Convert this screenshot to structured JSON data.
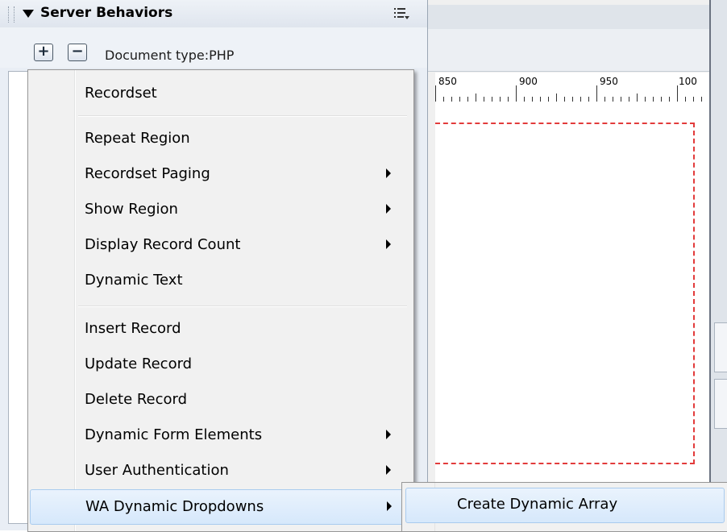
{
  "panel": {
    "title": "Server Behaviors",
    "add_button": "+",
    "remove_button": "−",
    "document_type": "Document type:PHP"
  },
  "ruler": {
    "ticks": [
      "850",
      "900",
      "950",
      "100"
    ]
  },
  "menu": {
    "items": [
      {
        "label": "Recordset",
        "submenu": false
      },
      {
        "label": "Repeat Region",
        "submenu": false
      },
      {
        "label": "Recordset Paging",
        "submenu": true
      },
      {
        "label": "Show Region",
        "submenu": true
      },
      {
        "label": "Display Record Count",
        "submenu": true
      },
      {
        "label": "Dynamic Text",
        "submenu": false
      },
      {
        "label": "Insert Record",
        "submenu": false
      },
      {
        "label": "Update Record",
        "submenu": false
      },
      {
        "label": "Delete Record",
        "submenu": false
      },
      {
        "label": "Dynamic Form Elements",
        "submenu": true
      },
      {
        "label": "User Authentication",
        "submenu": true
      },
      {
        "label": "WA Dynamic Dropdowns",
        "submenu": true,
        "highlighted": true
      }
    ]
  },
  "submenu": {
    "items": [
      {
        "label": "Create Dynamic Array",
        "highlighted": true
      }
    ]
  },
  "colors": {
    "highlight": "#d6e8fb",
    "dashed_border": "#e23b3b",
    "menu_bg": "#f1f1f1"
  }
}
